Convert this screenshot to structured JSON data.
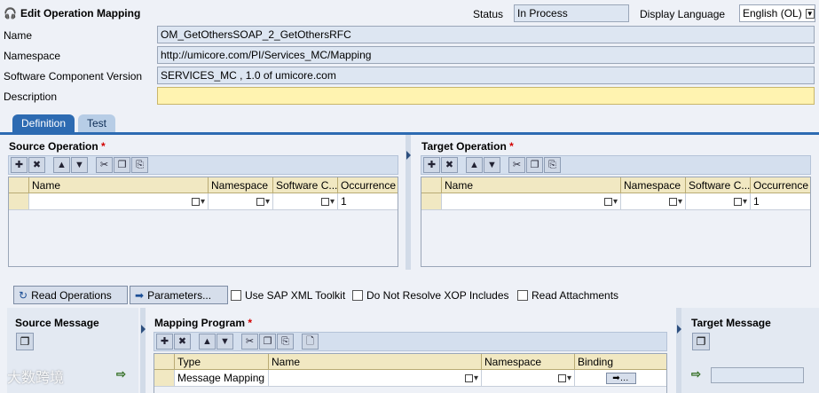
{
  "header": {
    "title": "Edit Operation Mapping",
    "status_label": "Status",
    "status_value": "In Process",
    "lang_label": "Display Language",
    "lang_value": "English (OL)"
  },
  "form": {
    "name_label": "Name",
    "name_value": "OM_GetOthersSOAP_2_GetOthersRFC",
    "namespace_label": "Namespace",
    "namespace_value": "http://umicore.com/PI/Services_MC/Mapping",
    "scv_label": "Software Component Version",
    "scv_value": "SERVICES_MC , 1.0 of umicore.com",
    "description_label": "Description",
    "description_value": ""
  },
  "tabs": [
    {
      "label": "Definition"
    },
    {
      "label": "Test"
    }
  ],
  "source_op": {
    "title": "Source Operation",
    "required": "*",
    "columns": [
      "Name",
      "Namespace",
      "Software C...",
      "Occurrence"
    ],
    "row": {
      "name": "",
      "namespace": "",
      "swc": "",
      "occurrence": "1"
    }
  },
  "target_op": {
    "title": "Target Operation",
    "required": "*",
    "columns": [
      "Name",
      "Namespace",
      "Software C...",
      "Occurrence"
    ],
    "row": {
      "name": "",
      "namespace": "",
      "swc": "",
      "occurrence": "1"
    }
  },
  "actions": {
    "read_ops": "Read Operations",
    "parameters": "Parameters...",
    "use_sap_xml": "Use SAP XML Toolkit",
    "no_xop": "Do Not Resolve XOP Includes",
    "read_attach": "Read Attachments"
  },
  "source_msg": {
    "title": "Source Message"
  },
  "target_msg": {
    "title": "Target Message"
  },
  "mapping": {
    "title": "Mapping Program",
    "required": "*",
    "columns": [
      "Type",
      "Name",
      "Namespace",
      "Binding"
    ],
    "row": {
      "type": "Message Mapping",
      "name": "",
      "namespace": ""
    }
  },
  "watermark": "大数跨境",
  "colors": {
    "accent": "#2d6bb2",
    "required": "#d20000",
    "desc_bg": "#fff3b0"
  }
}
